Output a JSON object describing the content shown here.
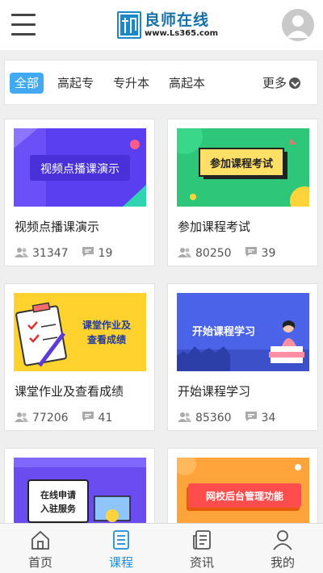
{
  "header": {
    "logo_name": "良师在线",
    "logo_url": "www.Ls365.com"
  },
  "categories": {
    "items": [
      "全部",
      "高起专",
      "专升本",
      "高起本"
    ],
    "active_index": 0,
    "more_label": "更多"
  },
  "courses": [
    {
      "title": "视频点播课演示",
      "students": "31347",
      "comments": "19",
      "thumb_text": "视频点播课演示"
    },
    {
      "title": "参加课程考试",
      "students": "80250",
      "comments": "39",
      "thumb_text": "参加课程考试"
    },
    {
      "title": "课堂作业及查看成绩",
      "students": "77206",
      "comments": "41",
      "thumb_text_line1": "课堂作业及",
      "thumb_text_line2": "查看成绩"
    },
    {
      "title": "开始课程学习",
      "students": "85360",
      "comments": "34",
      "thumb_text": "开始课程学习"
    },
    {
      "title": "",
      "thumb_text_line1": "在线申请",
      "thumb_text_line2": "入驻服务"
    },
    {
      "title": "",
      "thumb_text": "网校后台管理功能"
    }
  ],
  "tabbar": {
    "items": [
      "首页",
      "课程",
      "资讯",
      "我的"
    ],
    "active_index": 1,
    "active_color": "#1d8ee0"
  },
  "icons": [
    "menu-icon",
    "avatar-icon",
    "chevron-down-icon",
    "users-icon",
    "comment-icon",
    "home-icon",
    "course-icon",
    "news-icon",
    "profile-icon"
  ]
}
